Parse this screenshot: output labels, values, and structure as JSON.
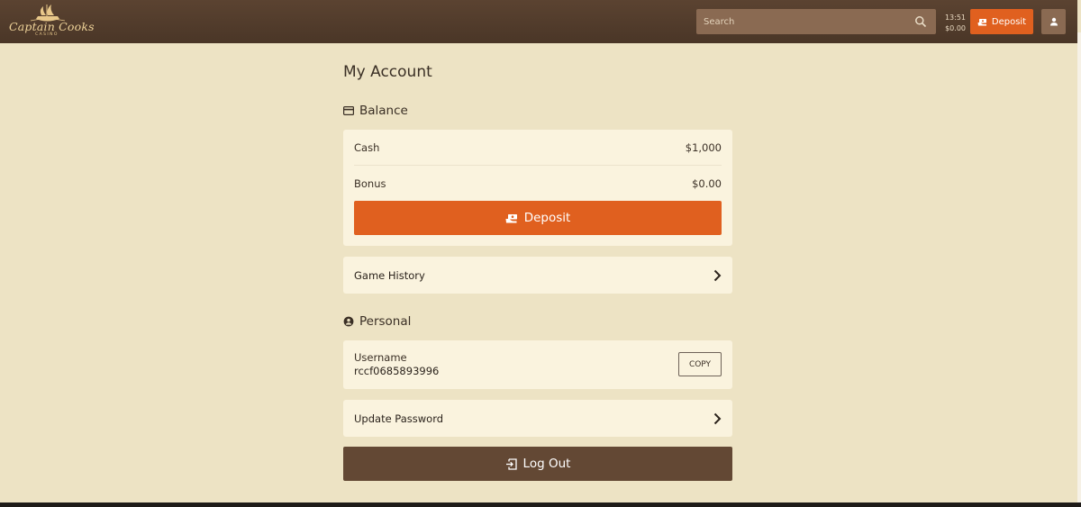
{
  "header": {
    "logo": {
      "name": "Captain Cooks",
      "sub": "CASINO"
    },
    "search_placeholder": "Search",
    "clock": {
      "time": "13:51",
      "balance": "$0.00"
    },
    "deposit_label": "Deposit",
    "icons": {
      "search": "search-icon",
      "deposit": "cash-icon",
      "user": "user-icon"
    }
  },
  "page": {
    "title": "My Account",
    "balance": {
      "heading": "Balance",
      "icon": "credit-card-icon",
      "rows": [
        {
          "label": "Cash",
          "value": "$1,000"
        },
        {
          "label": "Bonus",
          "value": "$0.00"
        }
      ],
      "deposit_label": "Deposit"
    },
    "game_history": {
      "label": "Game History",
      "icon": "chevron-right-icon"
    },
    "personal": {
      "heading": "Personal",
      "icon": "user-circle-icon",
      "username_label": "Username",
      "username_value": "rccf0685893996",
      "copy_label": "COPY"
    },
    "update_password": {
      "label": "Update Password",
      "icon": "chevron-right-icon"
    },
    "logout_label": "Log Out"
  },
  "colors": {
    "header": "#4f3a2a",
    "background": "#ede3c4",
    "card": "#faf3de",
    "accent": "#e0601f",
    "logout": "#634834"
  }
}
